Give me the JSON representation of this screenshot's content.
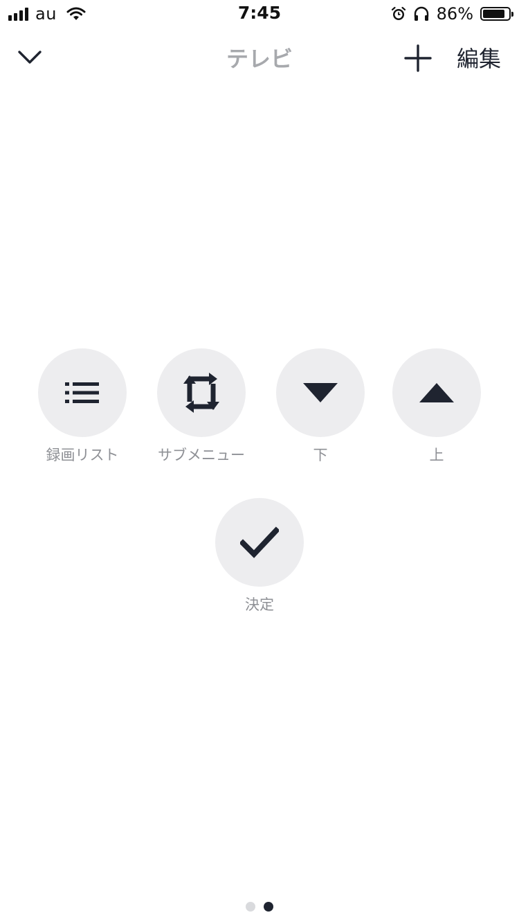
{
  "status_bar": {
    "carrier": "au",
    "time": "7:45",
    "battery_percent": "86%",
    "battery_level": 0.86,
    "icons": [
      "signal-icon",
      "wifi-icon",
      "alarm-icon",
      "headphones-icon",
      "battery-icon"
    ]
  },
  "nav": {
    "title": "テレビ",
    "edit_label": "編集",
    "icons": {
      "back": "chevron-down-icon",
      "add": "plus-icon"
    }
  },
  "buttons": {
    "record_list": {
      "label": "録画リスト",
      "icon": "list-icon"
    },
    "sub_menu": {
      "label": "サブメニュー",
      "icon": "repeat-arrows-icon"
    },
    "down": {
      "label": "下",
      "icon": "triangle-down-icon"
    },
    "up": {
      "label": "上",
      "icon": "triangle-up-icon"
    },
    "confirm": {
      "label": "決定",
      "icon": "checkmark-icon"
    }
  },
  "pagination": {
    "total": 2,
    "current": 2
  },
  "colors": {
    "icon_dark": "#1f2430",
    "button_bg": "#ededef",
    "label_gray": "#8e9095",
    "title_gray": "#a7a9ad",
    "dot_inactive": "#d9dadd"
  }
}
